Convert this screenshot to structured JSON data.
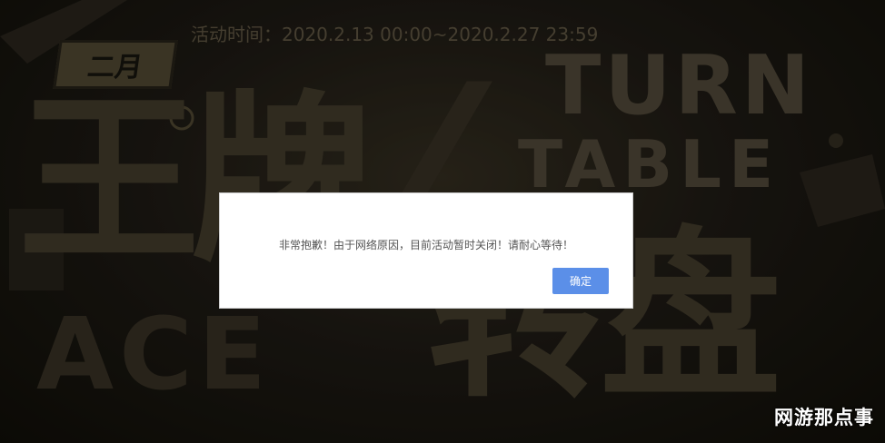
{
  "banner": {
    "month_badge": "二月",
    "event_time": "活动时间：2020.2.13 00:00~2020.2.27 23:59",
    "title_cn_1": "王牌",
    "title_cn_2": "转盘",
    "title_en_1": "TURN",
    "title_en_2": "TABLE",
    "title_en_3": "ACE",
    "slash": "/"
  },
  "dialog": {
    "message": "非常抱歉！由于网络原因，目前活动暂时关闭！请耐心等待！",
    "confirm_label": "确定"
  },
  "watermark": "网游那点事",
  "colors": {
    "confirm_button": "#5b8fe8",
    "background": "#1b1813",
    "title_gold": "#4a4231"
  }
}
